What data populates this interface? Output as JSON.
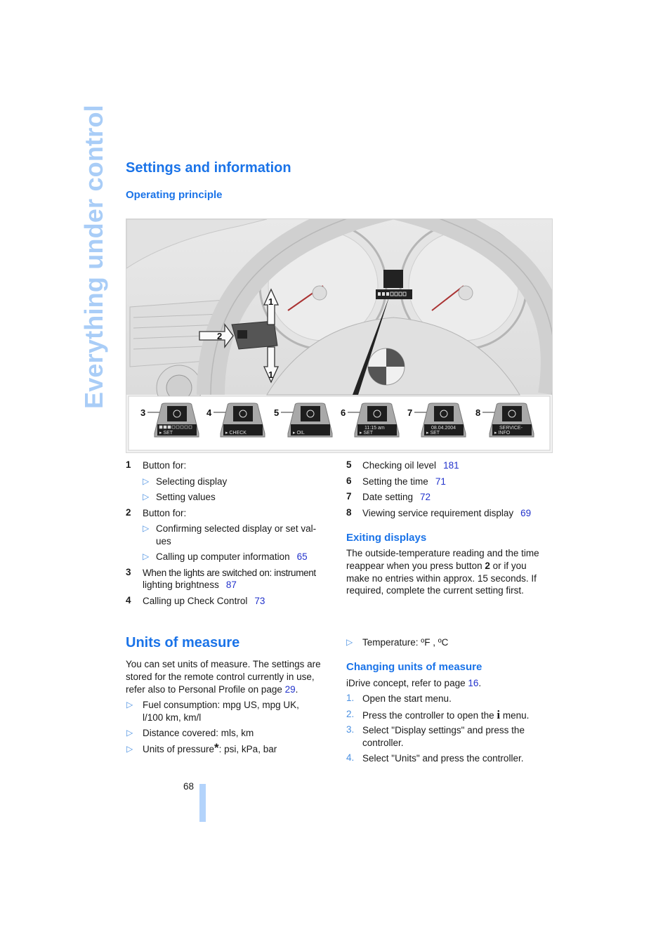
{
  "side_title": "Everything under control",
  "section1": {
    "title": "Settings and information",
    "subtitle": "Operating principle"
  },
  "figure": {
    "arrow_labels": [
      "1",
      "2",
      "1"
    ],
    "callouts": [
      {
        "num": "3",
        "icon": "instrument-lighting-icon",
        "line1": "",
        "line2": "SET",
        "bars": 3
      },
      {
        "num": "4",
        "icon": "car-icon",
        "line1": "",
        "line2": "CHECK"
      },
      {
        "num": "5",
        "icon": "oil-can-icon",
        "line1": "",
        "line2": "OIL"
      },
      {
        "num": "6",
        "icon": "clock-icon",
        "line1": "11:15 am",
        "line2": "SET"
      },
      {
        "num": "7",
        "icon": "calendar-icon",
        "line1": "08.04.2004",
        "line2": "SET"
      },
      {
        "num": "8",
        "icon": "car-service-icon",
        "line1": "SERVICE-",
        "line2": "INFO"
      }
    ]
  },
  "legend_left": [
    {
      "num": "1",
      "text": "Button for:",
      "subs": [
        {
          "text": "Selecting display"
        },
        {
          "text": "Setting values"
        }
      ]
    },
    {
      "num": "2",
      "text": "Button for:",
      "subs": [
        {
          "text": "Confirming selected display or set val-",
          "cont": "ues"
        },
        {
          "text": "Calling up computer information",
          "page": "65"
        }
      ]
    },
    {
      "num": "3",
      "text": "When the lights are switched on: instrument",
      "cont": "lighting brightness",
      "page": "87"
    },
    {
      "num": "4",
      "text": "Calling up Check Control",
      "page": "73"
    }
  ],
  "legend_right": [
    {
      "num": "5",
      "text": "Checking oil level",
      "page": "181"
    },
    {
      "num": "6",
      "text": "Setting the time",
      "page": "71"
    },
    {
      "num": "7",
      "text": "Date setting",
      "page": "72"
    },
    {
      "num": "8",
      "text": "Viewing service requirement display",
      "page": "69"
    }
  ],
  "exiting": {
    "title": "Exiting displays",
    "lines": [
      "The outside-temperature reading and the time",
      "reappear when you press button ",
      "make no entries within approx. 15 seconds. If",
      "required, complete the current setting first."
    ],
    "button_ref": "2",
    "line2_suffix": " or if you"
  },
  "units": {
    "title": "Units of measure",
    "intro": [
      "You can set units of measure. The settings are",
      "stored for the remote control currently in use,",
      "refer also to Personal Profile on page "
    ],
    "intro_page": "29",
    "intro_end": ".",
    "bullets": [
      {
        "text": "Fuel consumption: mpg US, mpg UK,",
        "cont": "l/100 km, km/l"
      },
      {
        "text": "Distance covered: mls, km"
      },
      {
        "text": "Units of pressure",
        "star": "*",
        "after": ": psi, kPa, bar"
      },
      {
        "text": "Temperature: ºF , ºC"
      }
    ]
  },
  "changing": {
    "title": "Changing units of measure",
    "intro": "iDrive concept, refer to page ",
    "intro_page": "16",
    "intro_end": ".",
    "steps": [
      {
        "num": "1.",
        "text": "Open the start menu."
      },
      {
        "num": "2.",
        "text": "Press the controller to open the",
        "icon": "i",
        "after": " menu."
      },
      {
        "num": "3.",
        "text": "Select \"Display settings\" and press the",
        "cont": "controller."
      },
      {
        "num": "4.",
        "text": "Select \"Units\" and press the controller."
      }
    ]
  },
  "page_number": "68",
  "colors": {
    "accent": "#1a73e8",
    "link": "#2233cc",
    "side_title": "#a9cdf7",
    "bar": "#b3d3fb"
  }
}
